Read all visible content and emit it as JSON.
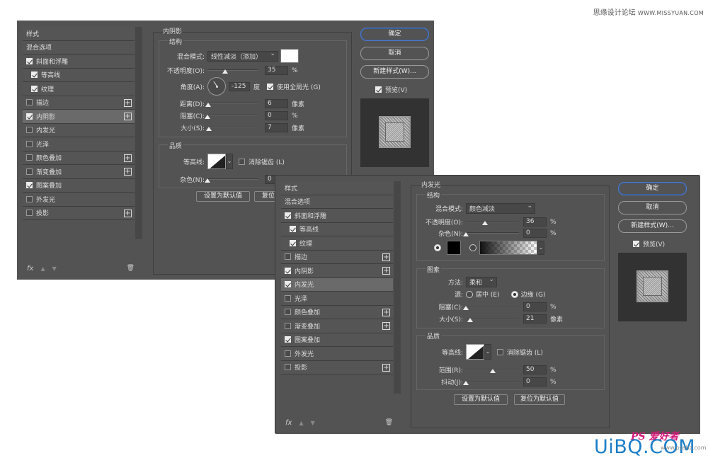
{
  "watermarks": {
    "top": "思缘设计论坛",
    "top_url": "WWW.MISSYUAN.COM",
    "bottom_logo": "UiBQ.COM",
    "bottom_ps": "PS 爱好者",
    "bottom_site": "www.psahz.com"
  },
  "dialog1": {
    "list": [
      {
        "label": "样式",
        "checkbox": false,
        "checked": false,
        "plus": false
      },
      {
        "label": "混合选项",
        "checkbox": false,
        "checked": false,
        "plus": false
      },
      {
        "label": "斜面和浮雕",
        "checkbox": true,
        "checked": true,
        "plus": false
      },
      {
        "label": "等高线",
        "checkbox": true,
        "checked": true,
        "plus": false,
        "sub": true
      },
      {
        "label": "纹理",
        "checkbox": true,
        "checked": true,
        "plus": false,
        "sub": true
      },
      {
        "label": "描边",
        "checkbox": true,
        "checked": false,
        "plus": true
      },
      {
        "label": "内阴影",
        "checkbox": true,
        "checked": true,
        "plus": true,
        "selected": true
      },
      {
        "label": "内发光",
        "checkbox": true,
        "checked": false,
        "plus": false
      },
      {
        "label": "光泽",
        "checkbox": true,
        "checked": false,
        "plus": false
      },
      {
        "label": "颜色叠加",
        "checkbox": true,
        "checked": false,
        "plus": true
      },
      {
        "label": "渐变叠加",
        "checkbox": true,
        "checked": false,
        "plus": true
      },
      {
        "label": "图案叠加",
        "checkbox": true,
        "checked": true,
        "plus": false
      },
      {
        "label": "外发光",
        "checkbox": true,
        "checked": false,
        "plus": false
      },
      {
        "label": "投影",
        "checkbox": true,
        "checked": false,
        "plus": true
      }
    ],
    "fx": "fx",
    "panel_title": "内阴影",
    "structure_title": "结构",
    "blend_label": "混合模式:",
    "blend_value": "线性减淡（添加）",
    "opacity_label": "不透明度(O):",
    "opacity_value": "35",
    "angle_label": "角度(A):",
    "angle_value": "-125",
    "angle_unit": "度",
    "global_light_label": "使用全局光 (G)",
    "distance_label": "距离(D):",
    "distance_value": "6",
    "choke_label": "阻塞(C):",
    "choke_value": "0",
    "size_label": "大小(S):",
    "size_value": "7",
    "quality_title": "品质",
    "contour_label": "等高线:",
    "antialias_label": "消除锯齿 (L)",
    "noise_label": "杂色(N):",
    "noise_value": "0",
    "percent": "%",
    "pixels": "像素",
    "default_btn": "设置为默认值",
    "reset_btn": "复位",
    "ok_btn": "确定",
    "cancel_btn": "取消",
    "new_style_btn": "新建样式(W)...",
    "preview_label": "预览(V)",
    "opacity_fraction": 0.35,
    "distance_fraction": 0.02,
    "choke_fraction": 0.0,
    "size_fraction": 0.03,
    "noise_fraction": 0.0
  },
  "dialog2": {
    "list": [
      {
        "label": "样式",
        "checkbox": false,
        "checked": false,
        "plus": false
      },
      {
        "label": "混合选项",
        "checkbox": false,
        "checked": false,
        "plus": false
      },
      {
        "label": "斜面和浮雕",
        "checkbox": true,
        "checked": true,
        "plus": false
      },
      {
        "label": "等高线",
        "checkbox": true,
        "checked": true,
        "plus": false,
        "sub": true
      },
      {
        "label": "纹理",
        "checkbox": true,
        "checked": true,
        "plus": false,
        "sub": true
      },
      {
        "label": "描边",
        "checkbox": true,
        "checked": false,
        "plus": true
      },
      {
        "label": "内阴影",
        "checkbox": true,
        "checked": true,
        "plus": true
      },
      {
        "label": "内发光",
        "checkbox": true,
        "checked": true,
        "plus": false,
        "selected": true
      },
      {
        "label": "光泽",
        "checkbox": true,
        "checked": false,
        "plus": false
      },
      {
        "label": "颜色叠加",
        "checkbox": true,
        "checked": false,
        "plus": true
      },
      {
        "label": "渐变叠加",
        "checkbox": true,
        "checked": false,
        "plus": true
      },
      {
        "label": "图案叠加",
        "checkbox": true,
        "checked": true,
        "plus": false
      },
      {
        "label": "外发光",
        "checkbox": true,
        "checked": false,
        "plus": false
      },
      {
        "label": "投影",
        "checkbox": true,
        "checked": false,
        "plus": true
      }
    ],
    "fx": "fx",
    "panel_title": "内发光",
    "structure_title": "结构",
    "blend_label": "混合模式:",
    "blend_value": "颜色减淡",
    "opacity_label": "不透明度(O):",
    "opacity_value": "36",
    "noise_label": "杂色(N):",
    "noise_value": "0",
    "elements_title": "图素",
    "method_label": "方法:",
    "method_value": "柔和",
    "source_label": "源:",
    "source_center": "居中 (E)",
    "source_edge": "边缘 (G)",
    "choke_label": "阻塞(C):",
    "choke_value": "0",
    "size_label": "大小(S):",
    "size_value": "21",
    "quality_title": "品质",
    "contour_label": "等高线:",
    "antialias_label": "消除锯齿 (L)",
    "range_label": "范围(R):",
    "range_value": "50",
    "jitter_label": "抖动(J):",
    "jitter_value": "0",
    "percent": "%",
    "pixels": "像素",
    "default_btn": "设置为默认值",
    "reset_btn": "复位为默认值",
    "ok_btn": "确定",
    "cancel_btn": "取消",
    "new_style_btn": "新建样式(W)...",
    "preview_label": "预览(V)",
    "opacity_fraction": 0.36,
    "noise_fraction": 0.0,
    "choke_fraction": 0.0,
    "size_fraction": 0.08,
    "range_fraction": 0.5,
    "jitter_fraction": 0.0
  },
  "colors": {
    "dialog_bg": "#535353",
    "accent": "#4f7acc"
  }
}
